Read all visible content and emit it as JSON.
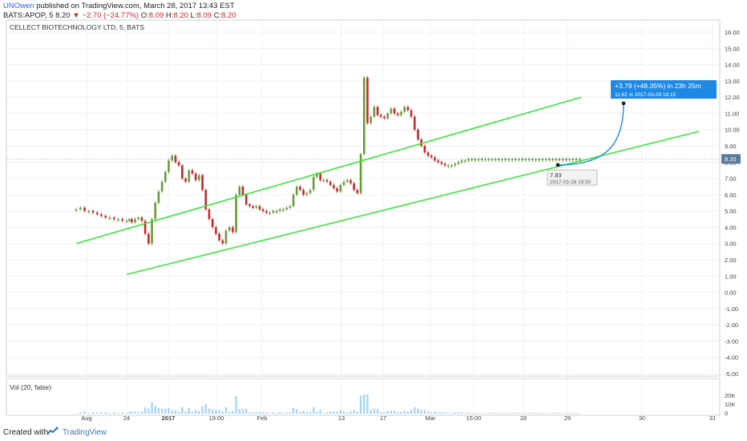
{
  "header": {
    "author": "UNOwen",
    "published_text": "published on TradingView.com, March 28, 2017 13:43 EST",
    "symbol": "BATS:APOP, 5",
    "price": "8.20",
    "change": "−2.70 (−24.77%)",
    "o_label": "O:",
    "o_value": "8.09",
    "h_label": "H:",
    "h_value": "8.20",
    "l_label": "L:",
    "l_value": "8.09",
    "c_label": "C:",
    "c_value": "8.20"
  },
  "footer": {
    "created_with": "Created with",
    "brand": "TradingView"
  },
  "chart_data": {
    "type": "line",
    "title": "CELLECT BIOTECHNOLOGY LTD, 5, BATS",
    "ylim": [
      -5,
      16
    ],
    "y_ticks": [
      "16.00",
      "15.00",
      "14.00",
      "13.00",
      "12.00",
      "11.00",
      "10.00",
      "9.00",
      "8.00",
      "7.00",
      "6.00",
      "5.00",
      "4.00",
      "3.00",
      "2.00",
      "1.00",
      "0.00",
      "-1.00",
      "-2.00",
      "-3.00",
      "-4.00",
      "-5.00"
    ],
    "x_ticks": [
      "Aug",
      "24",
      "2017",
      "19:00",
      "Feb",
      "13",
      "17",
      "Mar",
      "15:00",
      "28",
      "29",
      "30",
      "31"
    ],
    "last_price_label": "8.20",
    "last_price": 8.2,
    "x": [
      0,
      5,
      10,
      15,
      20,
      25,
      30,
      35,
      40,
      45,
      50,
      55,
      60,
      63,
      66,
      70,
      74,
      78,
      82,
      86,
      90,
      94,
      98,
      102,
      106,
      110,
      114,
      118,
      122,
      126,
      130,
      134,
      138,
      142,
      146,
      150,
      154,
      158,
      162,
      166,
      170,
      174,
      178,
      182,
      186,
      190,
      194,
      198,
      202,
      206,
      210,
      214,
      218,
      222,
      226,
      230,
      234,
      238,
      242,
      246,
      250,
      254,
      258,
      262,
      266,
      270,
      274,
      278,
      282,
      286,
      290,
      294,
      298,
      302,
      306,
      310,
      314,
      318,
      322,
      326,
      330,
      334,
      338,
      342,
      346,
      350,
      354,
      358,
      362,
      366,
      370,
      374,
      378,
      382,
      386,
      390,
      394,
      398,
      402,
      406,
      410,
      414,
      418,
      422,
      426,
      430,
      434,
      438,
      442,
      446,
      450,
      454,
      458,
      462,
      466,
      470,
      474,
      478,
      482,
      486,
      490,
      494,
      498,
      502,
      506,
      510,
      514,
      518,
      522,
      526,
      530,
      534,
      538,
      542,
      546,
      550,
      554,
      558,
      562,
      566,
      570,
      574,
      578,
      582,
      586,
      590,
      594,
      598
    ],
    "values": [
      5.1,
      5.2,
      5.0,
      5.0,
      4.9,
      4.8,
      4.7,
      4.6,
      4.6,
      4.5,
      4.5,
      4.4,
      4.4,
      4.5,
      4.3,
      4.5,
      4.6,
      4.4,
      3.6,
      3.0,
      4.5,
      5.5,
      6.2,
      6.8,
      7.4,
      8.1,
      8.4,
      8.0,
      7.8,
      7.0,
      6.8,
      7.5,
      7.3,
      6.9,
      7.2,
      6.3,
      5.1,
      4.5,
      4.0,
      3.6,
      3.2,
      3.0,
      3.8,
      4.0,
      3.7,
      6.0,
      6.5,
      6.0,
      5.4,
      5.3,
      5.2,
      5.3,
      5.1,
      5.0,
      4.9,
      4.9,
      5.0,
      5.0,
      5.1,
      5.1,
      5.2,
      5.3,
      6.0,
      6.5,
      6.3,
      6.0,
      6.1,
      6.3,
      7.1,
      7.3,
      6.9,
      6.9,
      6.8,
      6.6,
      6.4,
      6.2,
      6.6,
      6.8,
      6.9,
      6.7,
      6.3,
      6.1,
      8.5,
      13.2,
      10.4,
      10.8,
      11.4,
      10.9,
      10.8,
      10.7,
      11.0,
      11.3,
      11.0,
      10.9,
      11.1,
      11.4,
      11.2,
      10.8,
      10.0,
      9.4,
      9.0,
      8.6,
      8.4,
      8.3,
      8.1,
      8.0,
      7.9,
      7.8,
      7.8,
      7.8,
      7.9,
      8.0,
      8.1,
      8.1,
      8.2,
      8.2,
      8.2,
      8.2,
      8.2,
      8.2,
      8.2,
      8.2,
      8.2,
      8.2,
      8.2,
      8.2,
      8.2,
      8.2,
      8.2,
      8.2,
      8.2,
      8.2,
      8.2,
      8.2,
      8.2,
      8.2,
      8.2,
      8.2,
      8.2,
      8.2,
      8.2,
      8.2,
      8.2,
      8.2,
      8.2,
      8.2,
      8.2,
      8.2
    ],
    "volume_label": "Vol (20, false)",
    "volume_ticks": [
      "20K",
      "10K",
      "0"
    ],
    "channel_lines": [
      {
        "from": [
          0,
          3.0
        ],
        "to": [
          600,
          12.0
        ]
      },
      {
        "from": [
          60,
          1.1
        ],
        "to": [
          740,
          9.9
        ]
      }
    ],
    "projection": {
      "label": "+3.79 (+48.35%) in 23h 25m",
      "sublabel": "11.62  ⊘ 2017-03-29  18:15",
      "start_value": 7.83,
      "end_value": 11.62
    },
    "point_label": {
      "value": "7.83",
      "date": "2017-03-28 19:50"
    },
    "colors": {
      "up": "#6a9a3a",
      "down": "#c62828",
      "channel": "#39e639",
      "projection": "#1e88e5",
      "volume": "#90caf9"
    }
  }
}
